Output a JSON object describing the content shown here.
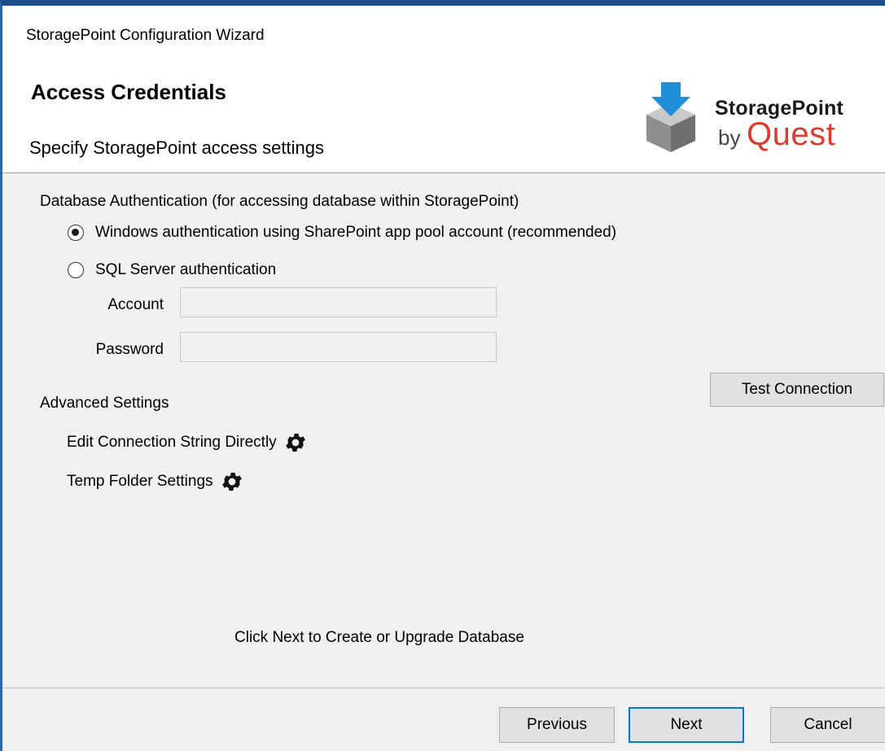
{
  "window": {
    "title": "StoragePoint Configuration Wizard"
  },
  "header": {
    "title": "Access Credentials",
    "subtitle": "Specify StoragePoint access settings",
    "logo": {
      "brand": "StoragePoint",
      "by": "by",
      "vendor": "Quest",
      "vendor_color": "#e03a2f",
      "arrow_color": "#1e8fd6"
    }
  },
  "auth": {
    "section_label": "Database Authentication (for accessing database within StoragePoint)",
    "options": [
      {
        "label": "Windows authentication using SharePoint app pool account (recommended)",
        "selected": true
      },
      {
        "label": "SQL Server authentication",
        "selected": false
      }
    ],
    "account_label": "Account",
    "account_value": "",
    "password_label": "Password",
    "password_value": ""
  },
  "test_connection_label": "Test Connection",
  "advanced": {
    "section_label": "Advanced Settings",
    "edit_connection_label": "Edit Connection String Directly",
    "temp_folder_label": "Temp Folder Settings",
    "icon": "gear-icon"
  },
  "hint": "Click Next to Create or Upgrade Database",
  "footer": {
    "previous_label": "Previous",
    "next_label": "Next",
    "cancel_label": "Cancel"
  },
  "colors": {
    "accent": "#0078d7",
    "title_border": "#1e4f8c"
  }
}
